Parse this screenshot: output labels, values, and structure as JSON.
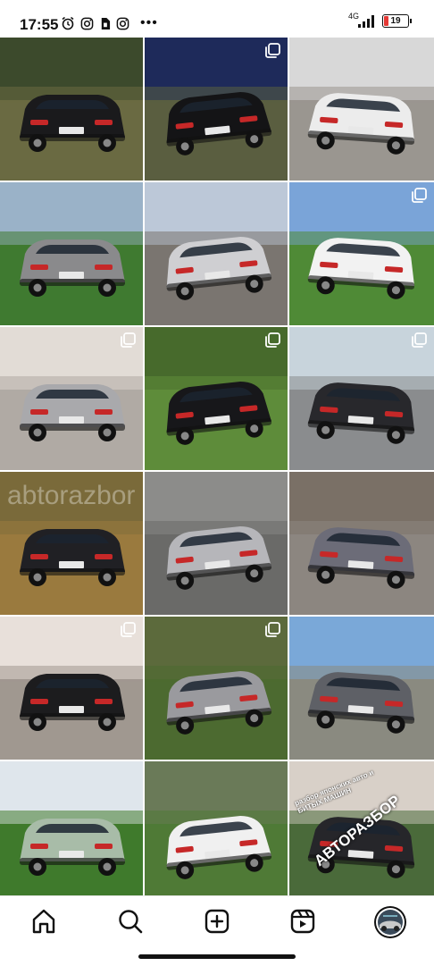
{
  "status_bar": {
    "time": "17:55",
    "network": "4G",
    "battery": "19",
    "more": "•••",
    "icons": [
      "alarm-icon",
      "instagram-icon",
      "sim-icon",
      "instagram-icon"
    ]
  },
  "tiles": [
    {
      "name": "post-1",
      "sky": "#3c4a2c",
      "ground": "#6a6a42",
      "car": "#1a1a1c",
      "multi": false
    },
    {
      "name": "post-2",
      "sky": "#1e2a5a",
      "ground": "#5a5e40",
      "car": "#141416",
      "multi": true
    },
    {
      "name": "post-3",
      "sky": "#d8d8d8",
      "ground": "#9a9690",
      "car": "#ececec",
      "multi": false
    },
    {
      "name": "post-4",
      "sky": "#9ab2c8",
      "ground": "#3f7a30",
      "car": "#8a8a8c",
      "multi": false
    },
    {
      "name": "post-5",
      "sky": "#bcc8d8",
      "ground": "#7a7570",
      "car": "#cfcfd2",
      "multi": false
    },
    {
      "name": "post-6",
      "sky": "#7aa4d8",
      "ground": "#4f8a36",
      "car": "#f2f2f2",
      "multi": true
    },
    {
      "name": "post-7",
      "sky": "#e2dcd6",
      "ground": "#b0aaa4",
      "car": "#a9a9ac",
      "multi": true
    },
    {
      "name": "post-8",
      "sky": "#476a2c",
      "ground": "#5e8c3a",
      "car": "#17171a",
      "multi": true
    },
    {
      "name": "post-9",
      "sky": "#c8d4dc",
      "ground": "#8a8c8e",
      "car": "#28282c",
      "multi": true
    },
    {
      "name": "post-10",
      "sky": "#7a6a3a",
      "ground": "#9a7a3e",
      "car": "#202024",
      "multi": false
    },
    {
      "name": "post-11",
      "sky": "#8c8c8a",
      "ground": "#6a6a68",
      "car": "#b6b6ba",
      "multi": false
    },
    {
      "name": "post-12",
      "sky": "#7a7066",
      "ground": "#8c8680",
      "car": "#6c6c78",
      "multi": false
    },
    {
      "name": "post-13",
      "sky": "#e8e0da",
      "ground": "#a09890",
      "car": "#1c1c1e",
      "multi": true
    },
    {
      "name": "post-14",
      "sky": "#5c6a3c",
      "ground": "#4c6a30",
      "car": "#9a9a9e",
      "multi": true
    },
    {
      "name": "post-15",
      "sky": "#7aa8d8",
      "ground": "#8a8a80",
      "car": "#5e6066",
      "multi": false
    },
    {
      "name": "post-16",
      "sky": "#dfe6ec",
      "ground": "#3f7a2c",
      "car": "#a8bca8",
      "multi": false
    },
    {
      "name": "post-17",
      "sky": "#6a7a58",
      "ground": "#4f7a36",
      "car": "#f0f0f0",
      "multi": false
    },
    {
      "name": "post-18",
      "sky": "#d8d0c8",
      "ground": "#4a6a3a",
      "car": "#26262a",
      "multi": false
    }
  ],
  "watermark": "abtorazbor",
  "collage": {
    "caption": "разбор японских авто и БИТЫХ МАШИН",
    "brand": "АВТОРАЗБОР"
  },
  "bottom_nav": {
    "items": [
      "home-icon",
      "search-icon",
      "create-icon",
      "reels-icon",
      "profile-avatar"
    ]
  }
}
